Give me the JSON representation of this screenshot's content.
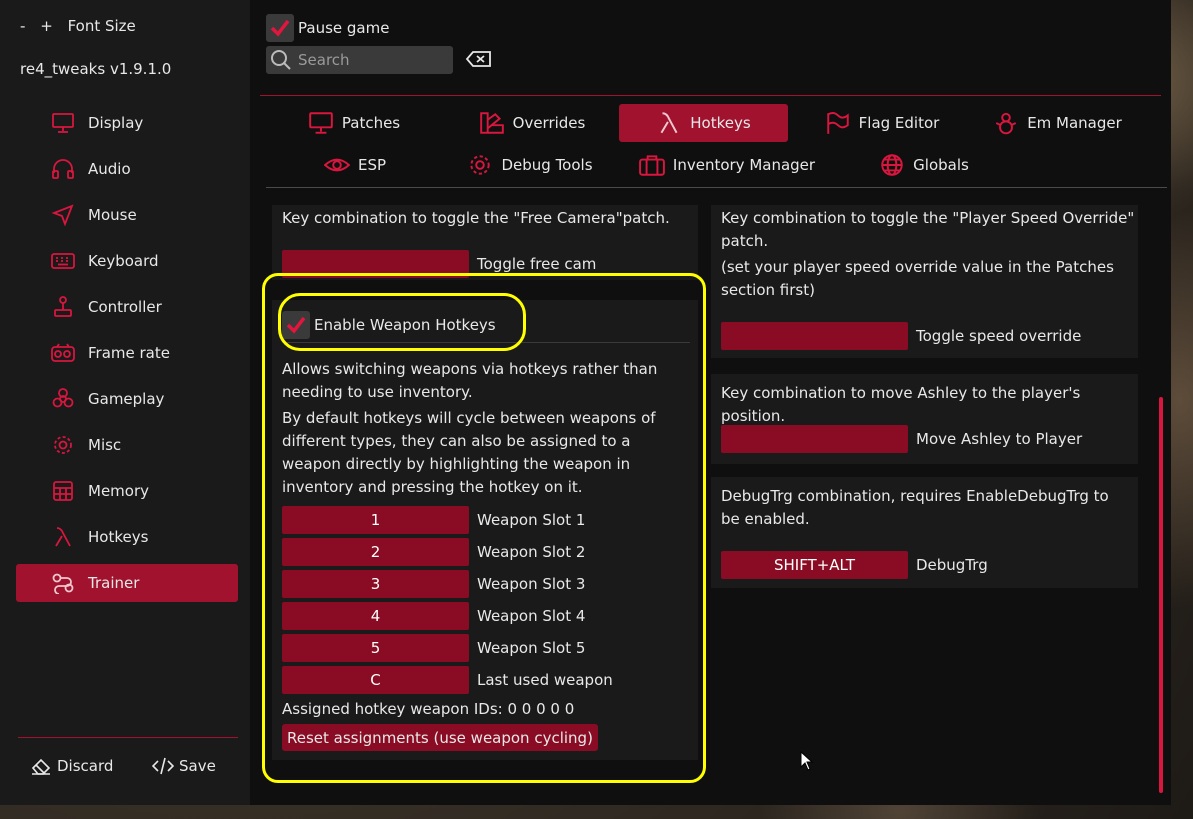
{
  "sidebar": {
    "font_minus": "-",
    "font_plus": "+",
    "font_label": "Font Size",
    "version": "re4_tweaks v1.9.1.0",
    "items": [
      {
        "label": "Display",
        "icon": "monitor-icon"
      },
      {
        "label": "Audio",
        "icon": "headphones-icon"
      },
      {
        "label": "Mouse",
        "icon": "cursor-arrow-icon"
      },
      {
        "label": "Keyboard",
        "icon": "keyboard-icon"
      },
      {
        "label": "Controller",
        "icon": "joystick-icon"
      },
      {
        "label": "Frame rate",
        "icon": "camera-icon"
      },
      {
        "label": "Gameplay",
        "icon": "biohazard-icon"
      },
      {
        "label": "Misc",
        "icon": "gear-icon"
      },
      {
        "label": "Memory",
        "icon": "memory-icon"
      },
      {
        "label": "Hotkeys",
        "icon": "lambda-icon"
      },
      {
        "label": "Trainer",
        "icon": "trainer-icon",
        "active": true
      }
    ],
    "discard_label": "Discard",
    "save_label": "Save"
  },
  "top": {
    "pause_label": "Pause game",
    "pause_checked": true,
    "search_placeholder": "Search"
  },
  "tabs": [
    {
      "label": "Patches",
      "icon": "monitor-icon"
    },
    {
      "label": "Overrides",
      "icon": "swatch-icon"
    },
    {
      "label": "Hotkeys",
      "icon": "lambda-icon",
      "active": true
    },
    {
      "label": "Flag Editor",
      "icon": "flag-icon"
    },
    {
      "label": "Em Manager",
      "icon": "snowman-icon"
    },
    {
      "label": "ESP",
      "icon": "eye-icon"
    },
    {
      "label": "Debug Tools",
      "icon": "gear-icon"
    },
    {
      "label": "Inventory Manager",
      "icon": "briefcase-icon"
    },
    {
      "label": "Globals",
      "icon": "globe-icon"
    }
  ],
  "left_col": {
    "freecam_desc": "Key combination to toggle the \"Free Camera\"patch.",
    "freecam_key": "",
    "freecam_label": "Toggle free cam",
    "weapon_enable_label": "Enable Weapon Hotkeys",
    "weapon_enabled": true,
    "weapon_desc1": "Allows switching weapons via hotkeys rather than needing to use inventory.",
    "weapon_desc2": "By default hotkeys will cycle between weapons of different types, they can also be assigned to a weapon directly by highlighting the weapon in inventory and pressing the hotkey on it.",
    "slots": [
      {
        "key": "1",
        "label": "Weapon Slot 1"
      },
      {
        "key": "2",
        "label": "Weapon Slot 2"
      },
      {
        "key": "3",
        "label": "Weapon Slot 3"
      },
      {
        "key": "4",
        "label": "Weapon Slot 4"
      },
      {
        "key": "5",
        "label": "Weapon Slot 5"
      },
      {
        "key": "C",
        "label": "Last used weapon"
      }
    ],
    "assigned_ids": "Assigned hotkey weapon IDs: 0 0 0 0 0",
    "reset_label": "Reset assignments (use weapon cycling)"
  },
  "right_col": {
    "speed_desc": "Key combination to toggle the \"Player Speed Override\" patch.",
    "speed_note": "(set your player speed override value in the Patches section first)",
    "speed_key": "",
    "speed_label": "Toggle speed override",
    "ashley_desc": "Key combination to move Ashley to the player's position.",
    "ashley_key": "",
    "ashley_label": "Move Ashley to Player",
    "debug_desc": "DebugTrg combination, requires EnableDebugTrg to be enabled.",
    "debug_key": "SHIFT+ALT",
    "debug_label": "DebugTrg"
  },
  "colors": {
    "accent": "#a0122e",
    "button": "#8a0c24",
    "highlight": "#ffff00"
  }
}
